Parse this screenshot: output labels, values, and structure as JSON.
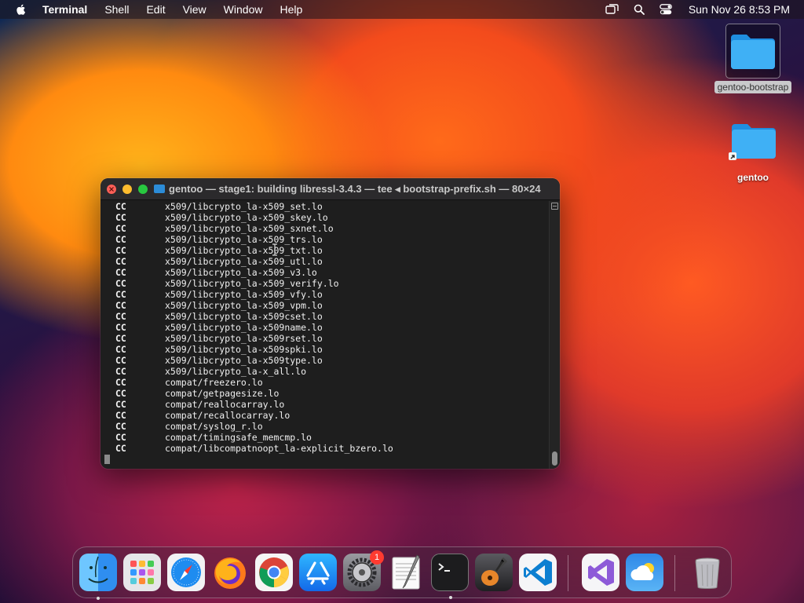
{
  "menubar": {
    "app_name": "Terminal",
    "items": [
      "Shell",
      "Edit",
      "View",
      "Window",
      "Help"
    ],
    "clock": "Sun Nov 26  8:53 PM"
  },
  "desktop": {
    "icons": [
      {
        "label": "gentoo-bootstrap",
        "selected": true
      },
      {
        "label": "gentoo",
        "selected": false
      }
    ]
  },
  "terminal": {
    "title": "gentoo — stage1: building libressl-3.4.3 — tee ◂ bootstrap-prefix.sh — 80×24",
    "lines": [
      {
        "cmd": "CC",
        "file": "x509/libcrypto_la-x509_set.lo"
      },
      {
        "cmd": "CC",
        "file": "x509/libcrypto_la-x509_skey.lo"
      },
      {
        "cmd": "CC",
        "file": "x509/libcrypto_la-x509_sxnet.lo"
      },
      {
        "cmd": "CC",
        "file": "x509/libcrypto_la-x509_trs.lo"
      },
      {
        "cmd": "CC",
        "file": "x509/libcrypto_la-x509_txt.lo"
      },
      {
        "cmd": "CC",
        "file": "x509/libcrypto_la-x509_utl.lo"
      },
      {
        "cmd": "CC",
        "file": "x509/libcrypto_la-x509_v3.lo"
      },
      {
        "cmd": "CC",
        "file": "x509/libcrypto_la-x509_verify.lo"
      },
      {
        "cmd": "CC",
        "file": "x509/libcrypto_la-x509_vfy.lo"
      },
      {
        "cmd": "CC",
        "file": "x509/libcrypto_la-x509_vpm.lo"
      },
      {
        "cmd": "CC",
        "file": "x509/libcrypto_la-x509cset.lo"
      },
      {
        "cmd": "CC",
        "file": "x509/libcrypto_la-x509name.lo"
      },
      {
        "cmd": "CC",
        "file": "x509/libcrypto_la-x509rset.lo"
      },
      {
        "cmd": "CC",
        "file": "x509/libcrypto_la-x509spki.lo"
      },
      {
        "cmd": "CC",
        "file": "x509/libcrypto_la-x509type.lo"
      },
      {
        "cmd": "CC",
        "file": "x509/libcrypto_la-x_all.lo"
      },
      {
        "cmd": "CC",
        "file": "compat/freezero.lo"
      },
      {
        "cmd": "CC",
        "file": "compat/getpagesize.lo"
      },
      {
        "cmd": "CC",
        "file": "compat/reallocarray.lo"
      },
      {
        "cmd": "CC",
        "file": "compat/recallocarray.lo"
      },
      {
        "cmd": "CC",
        "file": "compat/syslog_r.lo"
      },
      {
        "cmd": "CC",
        "file": "compat/timingsafe_memcmp.lo"
      },
      {
        "cmd": "CC",
        "file": "compat/libcompatnoopt_la-explicit_bzero.lo"
      }
    ]
  },
  "dock": {
    "apps": [
      "Finder",
      "Launchpad",
      "Safari",
      "Firefox",
      "Google Chrome",
      "App Store",
      "System Settings",
      "TextEdit",
      "Terminal",
      "GarageBand",
      "Visual Studio Code",
      "Visual Studio",
      "Weather",
      "Trash"
    ],
    "settings_badge": "1"
  }
}
